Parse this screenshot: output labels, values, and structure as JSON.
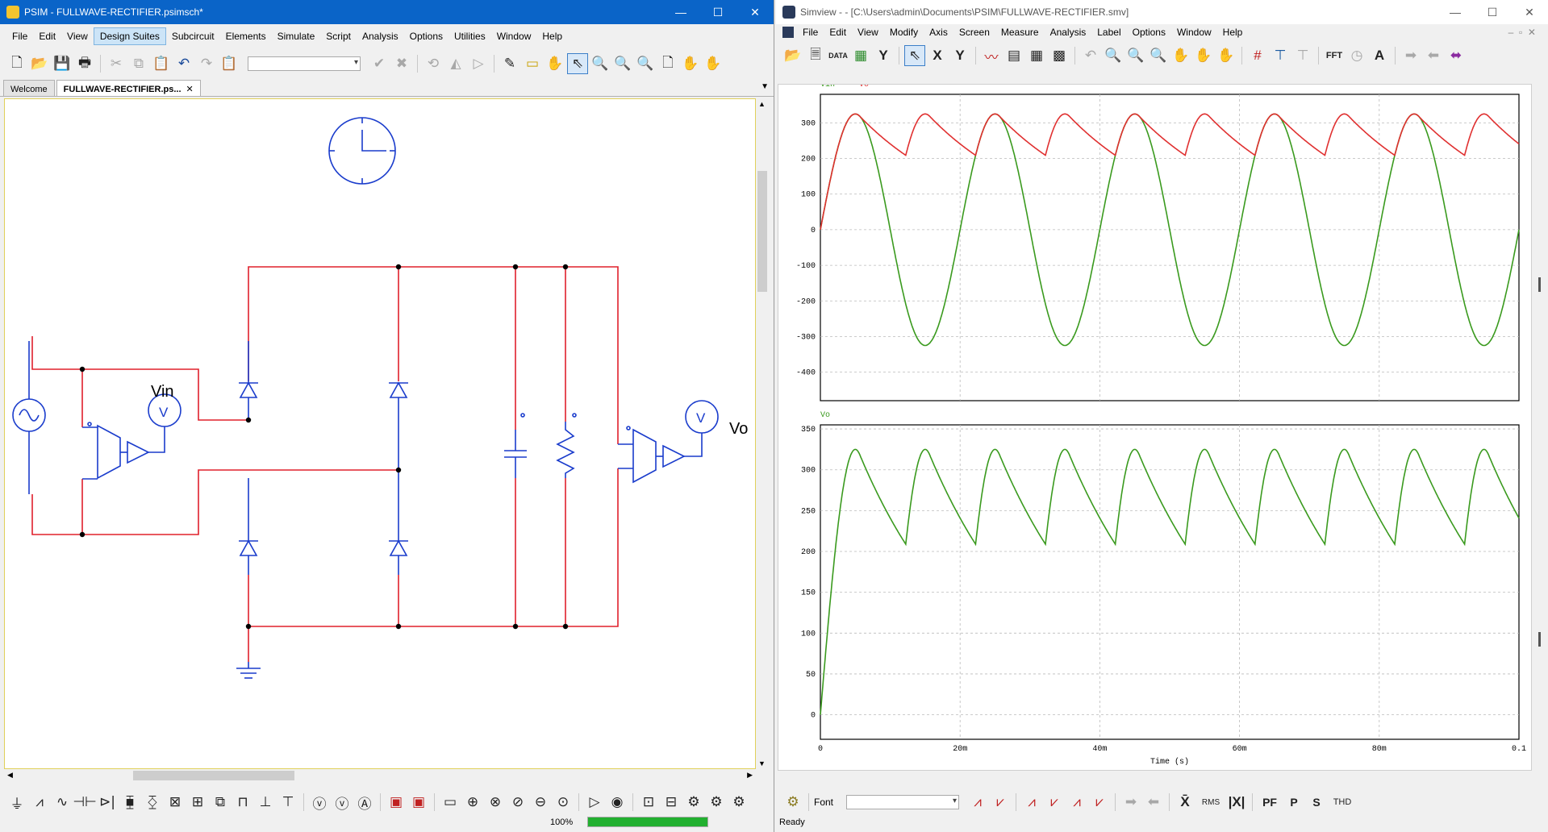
{
  "psim": {
    "title": "PSIM - FULLWAVE-RECTIFIER.psimsch*",
    "menu": [
      "File",
      "Edit",
      "View",
      "Design Suites",
      "Subcircuit",
      "Elements",
      "Simulate",
      "Script",
      "Analysis",
      "Options",
      "Utilities",
      "Window",
      "Help"
    ],
    "highlighted_menu": "Design Suites",
    "tabs": [
      {
        "label": "Welcome",
        "active": false
      },
      {
        "label": "FULLWAVE-RECTIFIER.ps...",
        "active": true
      }
    ],
    "tab_close": "✕",
    "labels": {
      "vin": "Vin",
      "vo": "Vo",
      "meter": "V"
    },
    "zoom": "100%",
    "progress": 1.0,
    "colors": {
      "wire": "#e0202c",
      "component": "#1a3ccc",
      "titlebar": "#0a64c8"
    }
  },
  "simview": {
    "title": "Simview -  - [C:\\Users\\admin\\Documents\\PSIM\\FULLWAVE-RECTIFIER.smv]",
    "menu": [
      "File",
      "Edit",
      "View",
      "Modify",
      "Axis",
      "Screen",
      "Measure",
      "Analysis",
      "Label",
      "Options",
      "Window",
      "Help"
    ],
    "bottom_toolbar": {
      "font_label": "Font",
      "buttons": [
        "RMS",
        "PF",
        "P",
        "S",
        "THD"
      ]
    },
    "status": "Ready",
    "toolbar_text": {
      "data": "DATA",
      "fft": "FFT",
      "x": "X",
      "y": "Y",
      "a": "A"
    }
  },
  "chart_data": [
    {
      "type": "line",
      "legend": [
        "Vin",
        "Vo"
      ],
      "series": [
        {
          "name": "Vin",
          "color": "#3a9a1e",
          "function": "325*sin(2*pi*50*t)"
        },
        {
          "name": "Vo",
          "color": "#e03030",
          "function": "peak-hold rectified, decay to ~275 between peaks"
        }
      ],
      "xlim": [
        0,
        0.1
      ],
      "ylim": [
        -480,
        380
      ],
      "yticks": [
        300,
        200,
        100,
        0,
        -100,
        -200,
        -300,
        -400
      ],
      "ytick_labels": [
        "300",
        "200",
        "100",
        "0",
        "-100",
        "-200",
        "-300",
        "-400"
      ],
      "grid": true
    },
    {
      "type": "line",
      "legend": [
        "Vo"
      ],
      "series": [
        {
          "name": "Vo",
          "color": "#3a9a1e"
        }
      ],
      "xlim": [
        0,
        0.1
      ],
      "ylim": [
        -30,
        355
      ],
      "yticks": [
        350,
        300,
        250,
        200,
        150,
        100,
        50,
        0
      ],
      "ytick_labels": [
        "350",
        "300",
        "250",
        "200",
        "150",
        "100",
        "50",
        "0"
      ],
      "xticks": [
        0,
        0.02,
        0.04,
        0.06,
        0.08,
        0.1
      ],
      "xtick_labels": [
        "0",
        "20m",
        "40m",
        "60m",
        "80m",
        "0.1"
      ],
      "xlabel": "Time (s)",
      "grid": true
    }
  ]
}
